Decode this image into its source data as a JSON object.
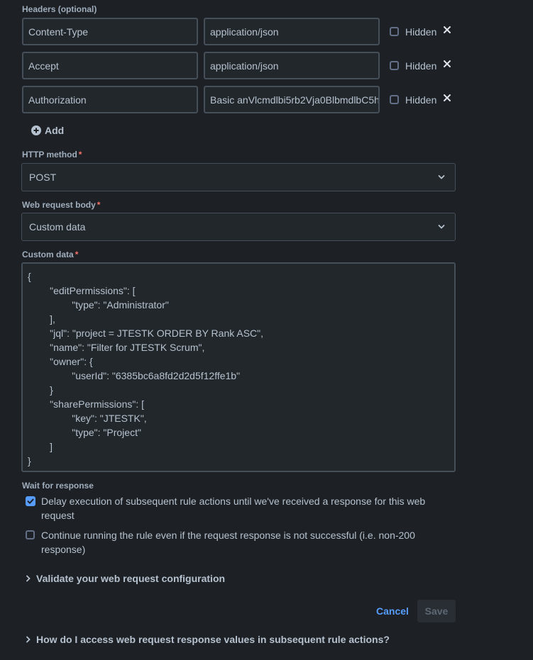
{
  "headers": {
    "label": "Headers (optional)",
    "rows": [
      {
        "key": "Content-Type",
        "value": "application/json",
        "hidden_label": "Hidden"
      },
      {
        "key": "Accept",
        "value": "application/json",
        "hidden_label": "Hidden"
      },
      {
        "key": "Authorization",
        "value": "Basic anVlcmdlbi5rb2Vja0BlbmdlbC5h",
        "hidden_label": "Hidden"
      }
    ],
    "add_label": "Add"
  },
  "http_method": {
    "label": "HTTP method",
    "required": "*",
    "value": "POST"
  },
  "body": {
    "label": "Web request body",
    "required": "*",
    "value": "Custom data"
  },
  "custom_data": {
    "label": "Custom data",
    "required": "*",
    "text": "{\n        \"editPermissions\": [\n                \"type\": \"Administrator\"\n        ],\n        \"jql\": \"project = JTESTK ORDER BY Rank ASC\",\n        \"name\": \"Filter for JTESTK Scrum\",\n        \"owner\": {\n                \"userId\": \"6385bc6a8fd2d2d5f12ffe1b\"\n        }\n        \"sharePermissions\": [\n                \"key\": \"JTESTK\",\n                \"type\": \"Project\"\n        ]\n}"
  },
  "wait": {
    "label": "Wait for response",
    "delay_text": "Delay execution of subsequent rule actions until we've received a response for this web request",
    "delay_checked": true,
    "continue_text": "Continue running the rule even if the request response is not successful (i.e. non-200 response)",
    "continue_checked": false
  },
  "validate_label": "Validate your web request configuration",
  "actions": {
    "cancel": "Cancel",
    "save": "Save"
  },
  "faq_label": "How do I access web request response values in subsequent rule actions?",
  "colors": {
    "background": "#1d2125",
    "accent": "#579dff",
    "required": "#f87168",
    "border": "#454f59"
  }
}
